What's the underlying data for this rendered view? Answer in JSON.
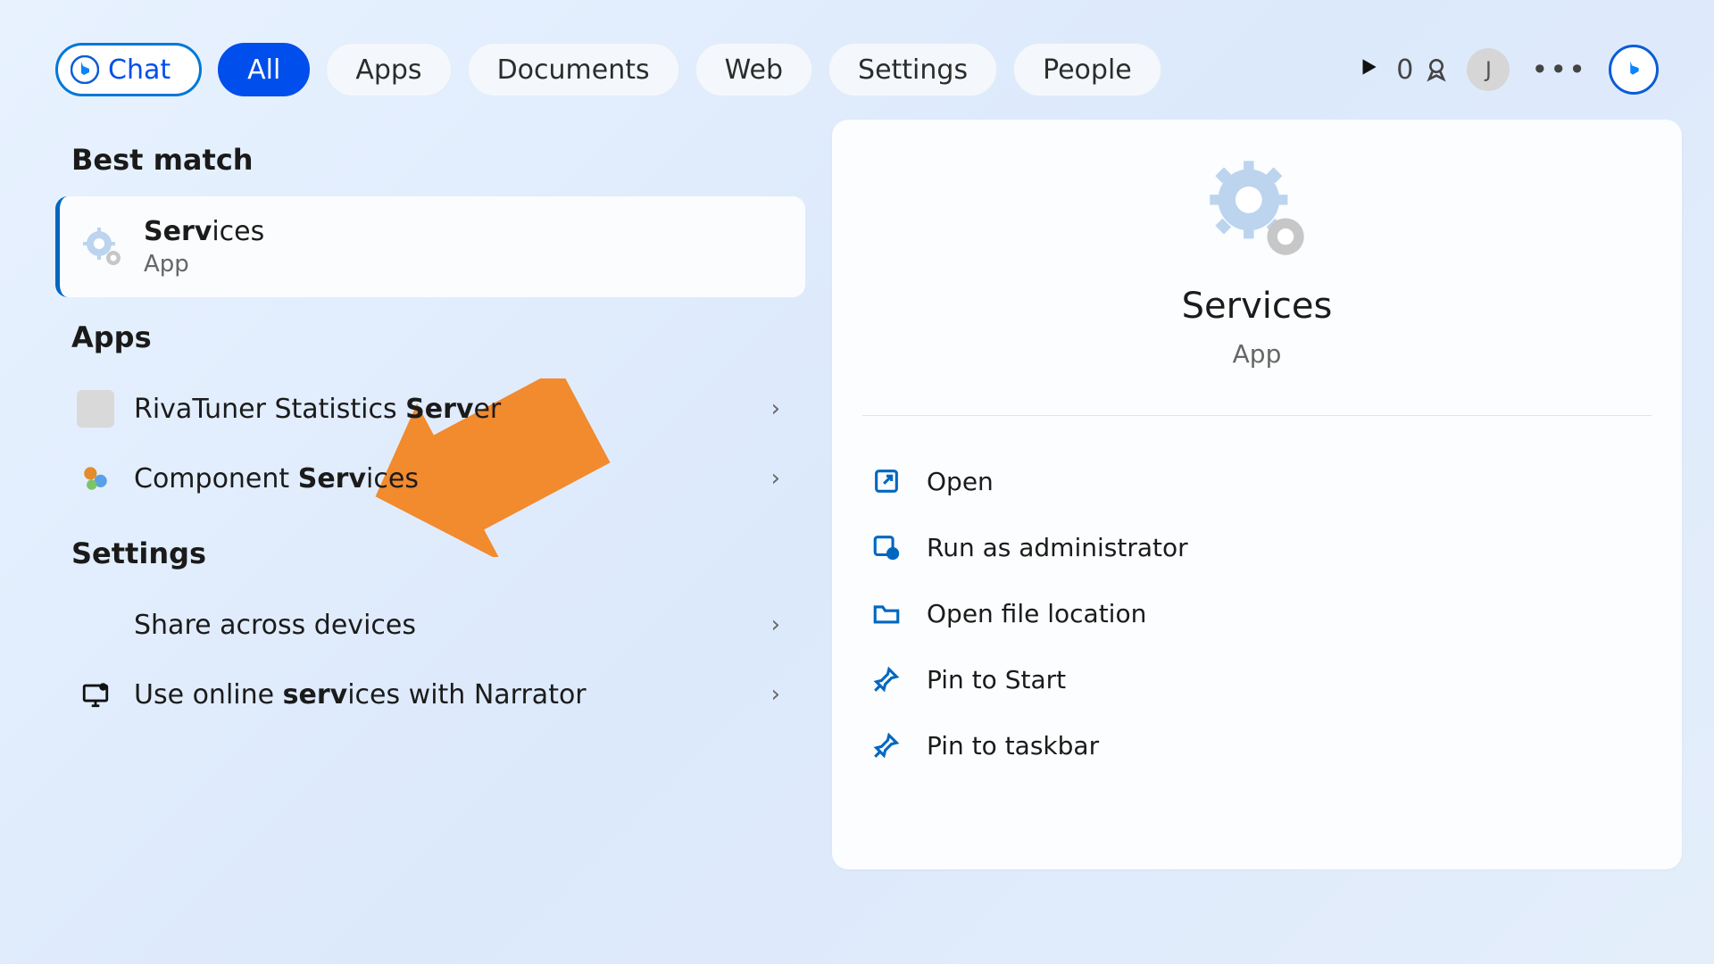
{
  "top": {
    "chat_label": "Chat",
    "filters": [
      "All",
      "Apps",
      "Documents",
      "Web",
      "Settings",
      "People"
    ],
    "active_filter_index": 0,
    "rewards_count": "0",
    "user_initial": "J"
  },
  "left": {
    "best_match_heading": "Best match",
    "best_match": {
      "name_bold": "Serv",
      "name_rest": "ices",
      "subtitle": "App"
    },
    "apps_heading": "Apps",
    "apps": [
      {
        "pre": "RivaTuner Statistics ",
        "bold": "Serv",
        "post": "er"
      },
      {
        "pre": "Component ",
        "bold": "Serv",
        "post": "ices"
      }
    ],
    "settings_heading": "Settings",
    "settings": [
      {
        "pre": "Share across devices",
        "bold": "",
        "post": ""
      },
      {
        "pre": "Use online ",
        "bold": "serv",
        "post": "ices with Narrator"
      }
    ]
  },
  "right": {
    "title": "Services",
    "subtitle": "App",
    "actions": [
      "Open",
      "Run as administrator",
      "Open file location",
      "Pin to Start",
      "Pin to taskbar"
    ]
  }
}
